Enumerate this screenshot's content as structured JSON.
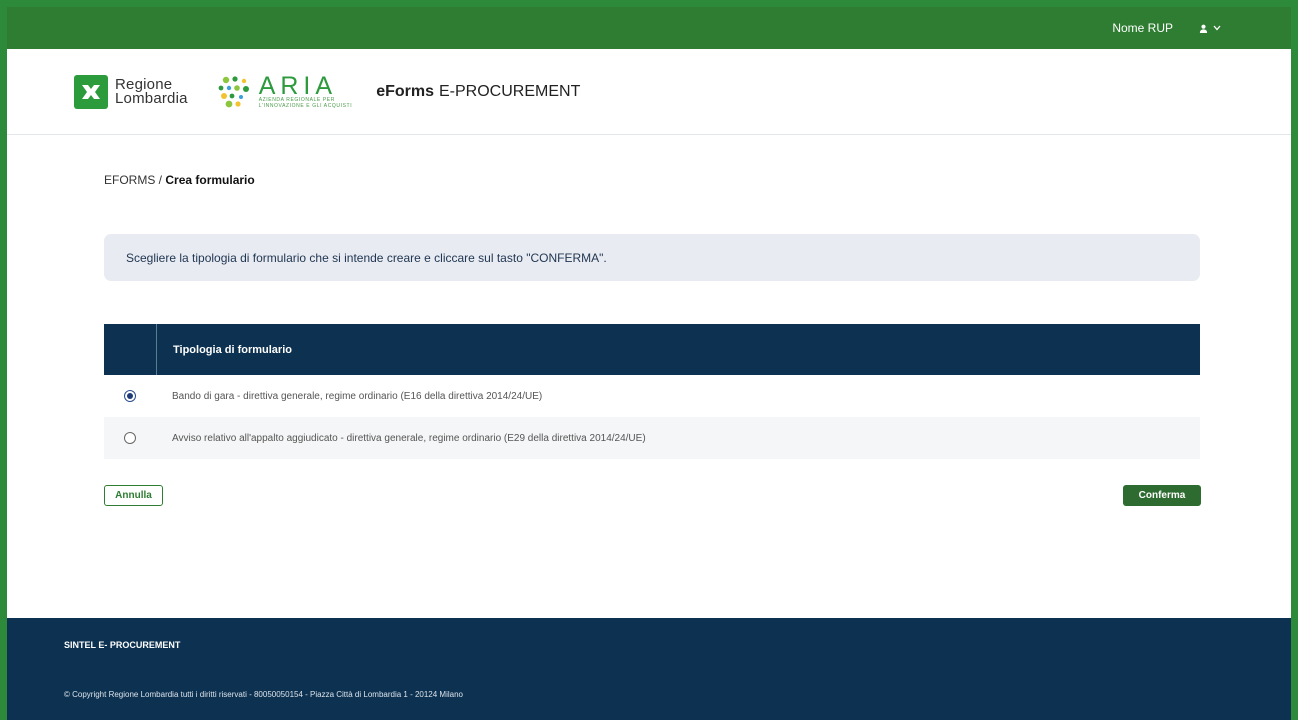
{
  "topbar": {
    "user_name": "Nome RUP"
  },
  "header": {
    "logo_region_line1": "Regione",
    "logo_region_line2": "Lombardia",
    "logo_aria_word": "ARIA",
    "logo_aria_sub1": "AZIENDA REGIONALE PER",
    "logo_aria_sub2": "L'INNOVAZIONE E GLI ACQUISTI",
    "app_title_bold": "eForms",
    "app_title_rest": "E-PROCUREMENT"
  },
  "breadcrumb": {
    "root": "EFORMS",
    "separator": " / ",
    "current": "Crea formulario"
  },
  "info_message": "Scegliere la tipologia di formulario che si intende creare e cliccare sul tasto \"CONFERMA\".",
  "table": {
    "header": "Tipologia di formulario",
    "rows": [
      {
        "label": "Bando di gara - direttiva generale, regime ordinario (E16 della direttiva 2014/24/UE)",
        "selected": true
      },
      {
        "label": "Avviso relativo all'appalto aggiudicato - direttiva generale, regime ordinario (E29 della direttiva 2014/24/UE)",
        "selected": false
      }
    ]
  },
  "actions": {
    "cancel_label": "Annulla",
    "confirm_label": "Conferma"
  },
  "footer": {
    "title": "SINTEL E- PROCUREMENT",
    "copyright": "© Copyright Regione Lombardia tutti i diritti riservati - 80050050154 - Piazza Città di Lombardia 1 - 20124 Milano"
  },
  "colors": {
    "brand_green": "#2e7d32",
    "navy": "#0d3251",
    "info_bg": "#e8ebf2"
  },
  "icons": {
    "user": "user-icon",
    "chevron": "chevron-down-icon"
  }
}
